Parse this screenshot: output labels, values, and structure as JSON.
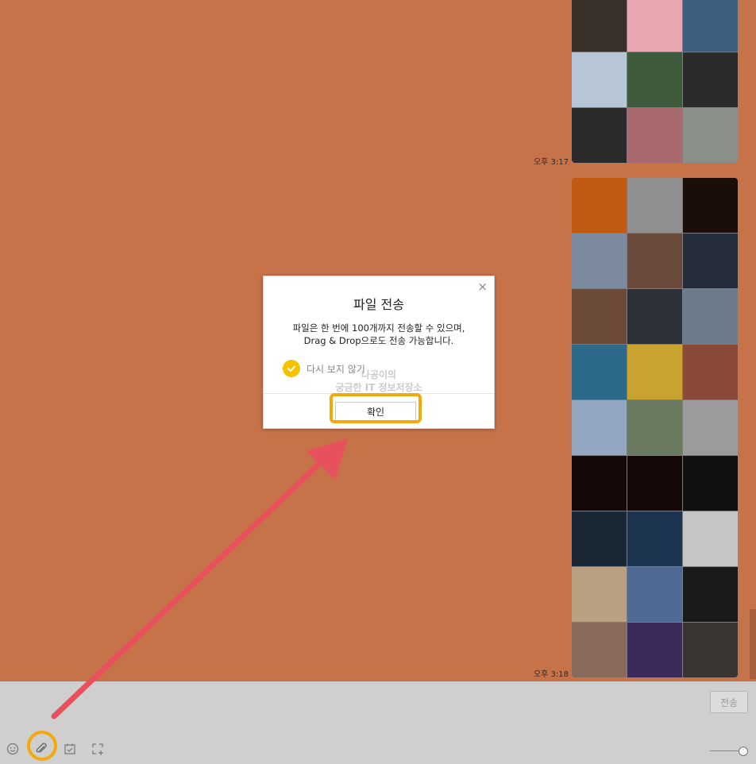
{
  "chat": {
    "messages": [
      {
        "time": "오후 3:17",
        "photo_count": 9,
        "photos": [
          "#3a302a",
          "#e7a7b0",
          "#3f5f7e",
          "#b7c6d6",
          "#3f5a3d",
          "#2b2b2b",
          "#2b2b2b",
          "#a86a6e",
          "#8a8f8a"
        ]
      },
      {
        "time": "오후 3:18",
        "photo_count": 27,
        "photos": [
          "#c25a12",
          "#8f8f8f",
          "#1b0d07",
          "#7c8aa0",
          "#6a4a3b",
          "#262d3a",
          "#6b4a3a",
          "#2d3038",
          "#6c7c8a",
          "#2d6a8a",
          "#c9a330",
          "#8a4a3a",
          "#93a8c0",
          "#6a7a60",
          "#9b9b9b",
          "#140808",
          "#140808",
          "#111111",
          "#1a2836",
          "#1d3450",
          "#c5c5c5",
          "#b8a080",
          "#4f6b95",
          "#1a1a1a",
          "#8a6a5a",
          "#3a2b5a",
          "#3b3531"
        ]
      }
    ]
  },
  "modal": {
    "title": "파일 전송",
    "body_line1": "파일은 한 번에 100개까지 전송할 수 있으며,",
    "body_line2": "Drag & Drop으로도 전송 가능합니다.",
    "checkbox_label": "다시 보지 않기",
    "checkbox_checked": true,
    "ok_label": "확인",
    "close_icon": "×"
  },
  "watermark": {
    "line1": "나공이의",
    "line2": "궁금한 IT 정보저장소"
  },
  "input_bar": {
    "send_label": "전송",
    "tools": [
      "emoticon-icon",
      "paperclip-icon",
      "calendar-check-icon",
      "capture-icon"
    ]
  },
  "colors": {
    "chat_background": "#c6734a",
    "highlight": "#f3a90c",
    "arrow": "#e8505b",
    "check": "#f5c400"
  }
}
